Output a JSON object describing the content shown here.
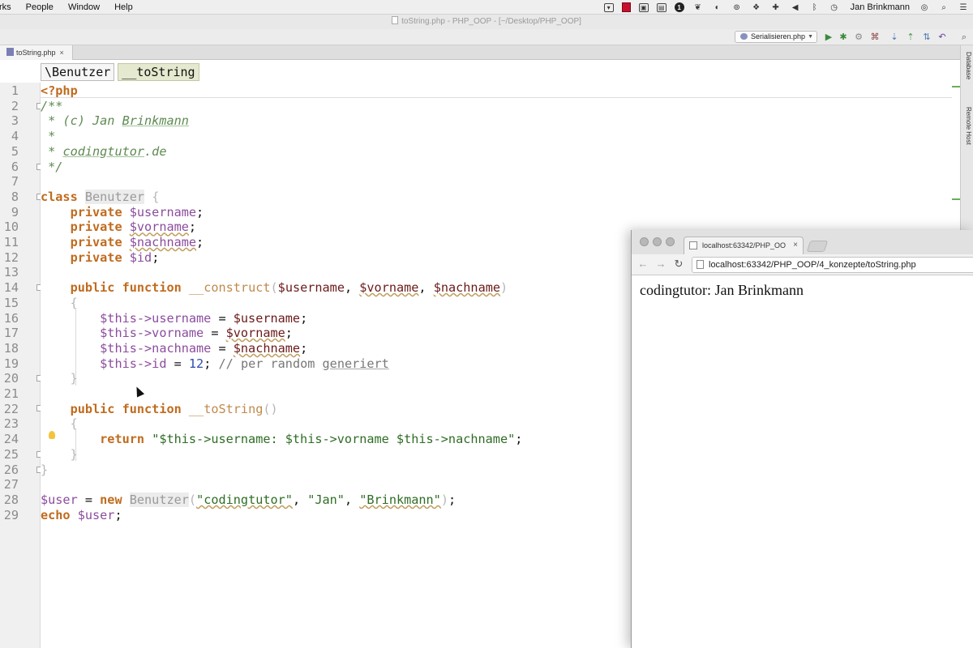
{
  "menubar": {
    "menus": [
      "rks",
      "People",
      "Window",
      "Help"
    ],
    "user": "Jan Brinkmann"
  },
  "ide": {
    "window_title": "toString.php - PHP_OOP - [~/Desktop/PHP_OOP]",
    "run_config": "Serialisieren.php",
    "file_tab": "toString.php",
    "right_tools": [
      "Database",
      "Remote Host"
    ],
    "breadcrumb": [
      "\\Benutzer",
      "__toString"
    ],
    "line_numbers": [
      "1",
      "2",
      "3",
      "4",
      "5",
      "6",
      "7",
      "8",
      "9",
      "10",
      "11",
      "12",
      "13",
      "14",
      "15",
      "16",
      "17",
      "18",
      "19",
      "20",
      "21",
      "22",
      "23",
      "24",
      "25",
      "26",
      "27",
      "28",
      "29"
    ],
    "code": {
      "l1": "<?php",
      "l2": "/**",
      "l3a": " * (c) Jan ",
      "l3b": "Brinkmann",
      "l4": " *",
      "l5a": " * ",
      "l5b": "codingtutor",
      "l5c": ".de",
      "l6": " */",
      "kw_class": "class",
      "class_name": "Benutzer",
      "brace_open": "{",
      "brace_close": "}",
      "kw_private": "private",
      "prop_username": "$username",
      "prop_vorname": "$vorname",
      "prop_nachname": "$nachname",
      "prop_id": "$id",
      "semicolon": ";",
      "kw_public": "public",
      "kw_function": "function",
      "fn_construct": "__construct",
      "fn_tostring": "__toString",
      "params_open": "(",
      "params_close": ")",
      "comma": ", ",
      "this_arrow": "$this->",
      "field_username": "username",
      "field_vorname": "vorname",
      "field_nachname": "nachname",
      "field_id": "id",
      "assign": " = ",
      "number_12": "12",
      "comment_a": "// per random ",
      "comment_b": "generiert",
      "empty_parens": "()",
      "kw_return": "return",
      "return_str_a": "\"$this->username: $this->vorname $this->nachname\"",
      "var_user": "$user",
      "kw_new": "new",
      "arg1": "\"codingtutor\"",
      "arg2": "\"Jan\"",
      "arg3": "\"Brinkmann\"",
      "kw_echo": "echo"
    }
  },
  "browser": {
    "tab_title": "localhost:63342/PHP_OO",
    "url": "localhost:63342/PHP_OOP/4_konzepte/toString.php",
    "page_text": "codingtutor: Jan Brinkmann"
  },
  "colors": {
    "keyword": "#c06b1e",
    "comment": "#5e8a51",
    "variable": "#8b4c9e",
    "string": "#2e6d24",
    "number": "#2f4bb0"
  }
}
